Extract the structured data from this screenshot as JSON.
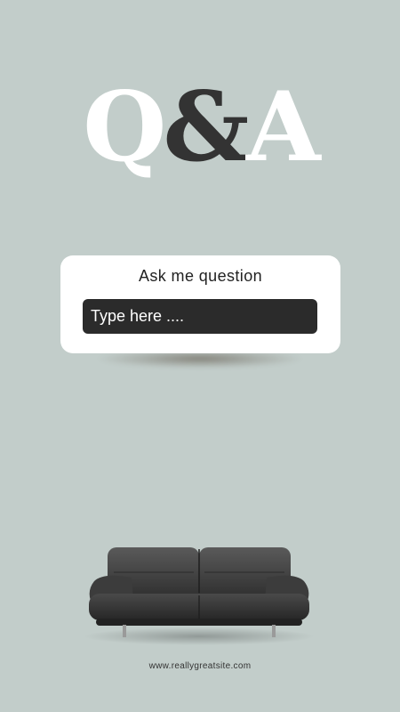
{
  "header": {
    "title_q": "Q",
    "title_amp": "&",
    "title_a": "A"
  },
  "card": {
    "prompt": "Ask me question",
    "input_placeholder": "Type here ...."
  },
  "footer": {
    "website": "www.reallygreatsite.com"
  },
  "colors": {
    "background": "#c2cdca",
    "card": "#ffffff",
    "input": "#2b2b2b",
    "accent_dark": "#333333"
  },
  "icons": {
    "sofa": "sofa-image"
  }
}
